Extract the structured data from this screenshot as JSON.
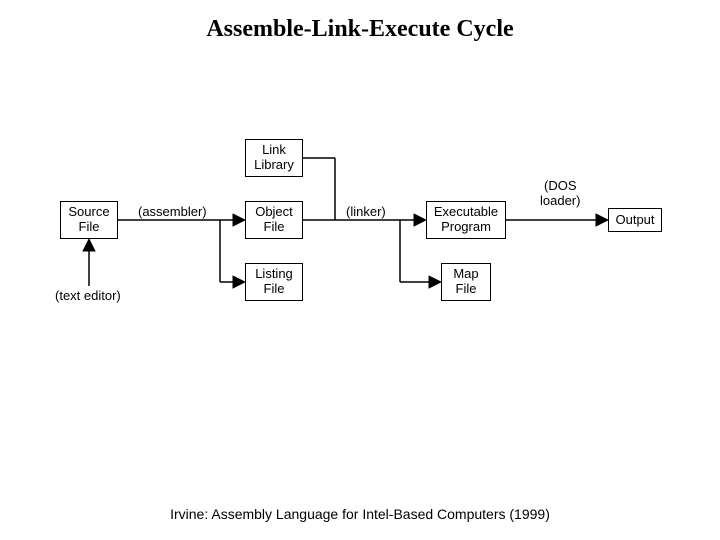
{
  "title": "Assemble-Link-Execute Cycle",
  "footer": "Irvine: Assembly Language for Intel-Based Computers (1999)",
  "labels": {
    "assembler": "(assembler)",
    "linker": "(linker)",
    "dos1": "(DOS",
    "dos2": "loader)",
    "text_editor": "(text editor)"
  },
  "nodes": {
    "source1": "Source",
    "source2": "File",
    "linklib1": "Link",
    "linklib2": "Library",
    "object1": "Object",
    "object2": "File",
    "listing1": "Listing",
    "listing2": "File",
    "exec1": "Executable",
    "exec2": "Program",
    "map1": "Map",
    "map2": "File",
    "output": "Output"
  },
  "diagram": {
    "description": "Flow diagram of the Assemble-Link-Execute cycle.",
    "nodes": [
      {
        "id": "source",
        "label": "Source File"
      },
      {
        "id": "linklib",
        "label": "Link Library"
      },
      {
        "id": "object",
        "label": "Object File"
      },
      {
        "id": "listing",
        "label": "Listing File"
      },
      {
        "id": "exec",
        "label": "Executable Program"
      },
      {
        "id": "map",
        "label": "Map File"
      },
      {
        "id": "output",
        "label": "Output"
      }
    ],
    "edges": [
      {
        "from": "text_editor_label",
        "to": "source",
        "via": "(text editor)"
      },
      {
        "from": "source",
        "to": "object",
        "via": "(assembler)"
      },
      {
        "from": "source",
        "to": "listing",
        "via": "(assembler)"
      },
      {
        "from": "linklib",
        "to": "exec",
        "via": "(linker)"
      },
      {
        "from": "object",
        "to": "exec",
        "via": "(linker)"
      },
      {
        "from": "object",
        "to": "map",
        "via": "(linker)"
      },
      {
        "from": "exec",
        "to": "output",
        "via": "(DOS loader)"
      }
    ]
  }
}
